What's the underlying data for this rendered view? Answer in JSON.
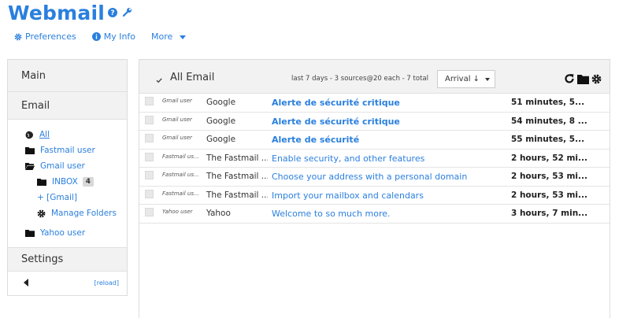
{
  "app": {
    "title": "Webmail"
  },
  "topnav": {
    "preferences": "Preferences",
    "my_info": "My Info",
    "more": "More"
  },
  "sidebar": {
    "main": "Main",
    "email": "Email",
    "folders": [
      {
        "label": "All",
        "icon": "globe-icon"
      },
      {
        "label": "Fastmail user",
        "icon": "folder-icon"
      },
      {
        "label": "Gmail user",
        "icon": "folder-open-icon"
      },
      {
        "label": "INBOX",
        "icon": "folder-icon",
        "badge": "4"
      },
      {
        "label": "+ [Gmail]"
      },
      {
        "label": "Manage Folders",
        "icon": "gear-icon"
      },
      {
        "label": "Yahoo user",
        "icon": "folder-icon"
      }
    ],
    "settings": "Settings",
    "reload": "[reload]"
  },
  "main": {
    "title": "All Email",
    "filter": "last 7 days - 3 sources@20 each - 7 total",
    "sort": "Arrival ↓",
    "actions": [
      "refresh-icon",
      "folder-icon",
      "gear-icon"
    ],
    "rows": [
      {
        "account": "Gmail user",
        "from": "Google",
        "subject": "Alerte de sécurité critique",
        "time": "51 minutes, 5...",
        "unread": true
      },
      {
        "account": "Gmail user",
        "from": "Google",
        "subject": "Alerte de sécurité critique",
        "time": "54 minutes, 8 ...",
        "unread": true
      },
      {
        "account": "Gmail user",
        "from": "Google",
        "subject": "Alerte de sécurité",
        "time": "55 minutes, 5...",
        "unread": true
      },
      {
        "account": "Fastmail us...",
        "from": "The Fastmail ...",
        "subject": "Enable security, and other features",
        "time": "2 hours, 52 mi...",
        "unread": false
      },
      {
        "account": "Fastmail us...",
        "from": "The Fastmail ...",
        "subject": "Choose your address with a personal domain",
        "time": "2 hours, 53 mi...",
        "unread": false
      },
      {
        "account": "Fastmail us...",
        "from": "The Fastmail ...",
        "subject": "Import your mailbox and calendars",
        "time": "2 hours, 53 mi...",
        "unread": false
      },
      {
        "account": "Yahoo user",
        "from": "Yahoo",
        "subject": "Welcome to so much more.",
        "time": "3 hours, 7 min...",
        "unread": false
      }
    ]
  },
  "colors": {
    "accent": "#2a7fde",
    "panel_bg": "#f2f2f2"
  }
}
